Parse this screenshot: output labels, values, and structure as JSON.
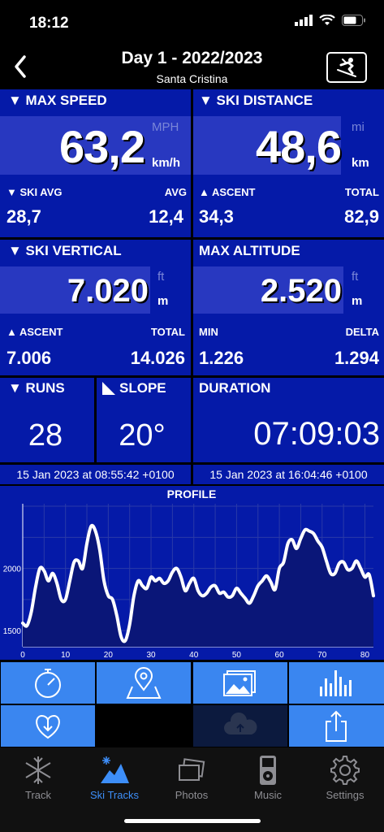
{
  "status": {
    "time": "18:12"
  },
  "header": {
    "title": "Day 1 - 2022/2023",
    "subtitle": "Santa Cristina"
  },
  "speed": {
    "label": "▼ MAX SPEED",
    "value": "63,2",
    "unit_alt": "MPH",
    "unit": "km/h",
    "sub_left_label": "▼ SKI AVG",
    "sub_right_label": "AVG",
    "sub_left_value": "28,7",
    "sub_right_value": "12,4"
  },
  "distance": {
    "label": "▼ SKI DISTANCE",
    "value": "48,6",
    "unit_alt": "mi",
    "unit": "km",
    "sub_left_label": "▲ ASCENT",
    "sub_right_label": "TOTAL",
    "sub_left_value": "34,3",
    "sub_right_value": "82,9"
  },
  "vertical": {
    "label": "▼ SKI VERTICAL",
    "value": "7.020",
    "unit_alt": "ft",
    "unit": "m",
    "sub_left_label": "▲ ASCENT",
    "sub_right_label": "TOTAL",
    "sub_left_value": "7.006",
    "sub_right_value": "14.026"
  },
  "altitude": {
    "label": "MAX ALTITUDE",
    "value": "2.520",
    "unit_alt": "ft",
    "unit": "m",
    "sub_left_label": "MIN",
    "sub_right_label": "DELTA",
    "sub_left_value": "1.226",
    "sub_right_value": "1.294"
  },
  "runs": {
    "label": "▼ RUNS",
    "value": "28"
  },
  "slope": {
    "label": "SLOPE",
    "value": "20°"
  },
  "duration": {
    "label": "DURATION",
    "value": "07:09:03"
  },
  "dates": {
    "start": "15 Jan 2023 at 08:55:42 +0100",
    "end": "15 Jan 2023 at 16:04:46 +0100"
  },
  "chart_data": {
    "type": "line",
    "title": "PROFILE",
    "xlim": [
      0,
      82
    ],
    "ylim": [
      1370,
      2520
    ],
    "x_ticks": [
      0,
      10,
      20,
      30,
      40,
      50,
      60,
      70,
      80
    ],
    "y_ticks": [
      1500,
      2000
    ],
    "x": [
      0,
      1,
      2,
      3,
      4,
      5,
      6,
      7,
      8,
      9,
      10,
      11,
      12,
      13,
      14,
      15,
      16,
      17,
      18,
      19,
      20,
      21,
      22,
      23,
      24,
      25,
      26,
      27,
      28,
      29,
      30,
      31,
      32,
      33,
      34,
      35,
      36,
      37,
      38,
      39,
      40,
      41,
      42,
      43,
      44,
      45,
      46,
      47,
      48,
      49,
      50,
      51,
      52,
      53,
      54,
      55,
      56,
      57,
      58,
      59,
      60,
      61,
      62,
      63,
      64,
      65,
      66,
      67,
      68,
      69,
      70,
      71,
      72,
      73,
      74,
      75,
      76,
      77,
      78,
      79,
      80,
      81,
      82
    ],
    "y": [
      1560,
      1540,
      1650,
      1850,
      2000,
      1980,
      1900,
      1960,
      1880,
      1750,
      1750,
      1900,
      2050,
      2060,
      2000,
      2200,
      2340,
      2300,
      2150,
      1900,
      1780,
      1750,
      1620,
      1450,
      1420,
      1550,
      1780,
      1900,
      1860,
      1840,
      1930,
      1900,
      1920,
      1880,
      1900,
      1970,
      2000,
      1930,
      1820,
      1880,
      1920,
      1820,
      1780,
      1800,
      1850,
      1860,
      1800,
      1810,
      1770,
      1780,
      1840,
      1800,
      1760,
      1720,
      1780,
      1860,
      1900,
      1940,
      1890,
      1830,
      2000,
      2050,
      2200,
      2230,
      2160,
      2240,
      2310,
      2300,
      2280,
      2220,
      2170,
      2060,
      1960,
      1960,
      2040,
      2050,
      1990,
      2000,
      2060,
      2000,
      1930,
      1950,
      1780
    ]
  },
  "actions": [
    {
      "icon": "stopwatch-icon"
    },
    {
      "icon": "map-pin-icon"
    },
    {
      "icon": "photos-icon"
    },
    {
      "icon": "bar-chart-icon"
    },
    {
      "icon": "heart-download-icon"
    },
    {
      "icon": "cloud-upload-icon"
    },
    {
      "icon": "share-icon"
    }
  ],
  "tabs": [
    {
      "label": "Track",
      "icon": "snowflake-icon"
    },
    {
      "label": "Ski Tracks",
      "icon": "mountain-icon"
    },
    {
      "label": "Photos",
      "icon": "photos-icon"
    },
    {
      "label": "Music",
      "icon": "ipod-icon"
    },
    {
      "label": "Settings",
      "icon": "gear-icon"
    }
  ],
  "colors": {
    "panel": "#051aa8",
    "box": "#2838c0",
    "button": "#3a86f0",
    "accent": "#3d8ef8"
  }
}
